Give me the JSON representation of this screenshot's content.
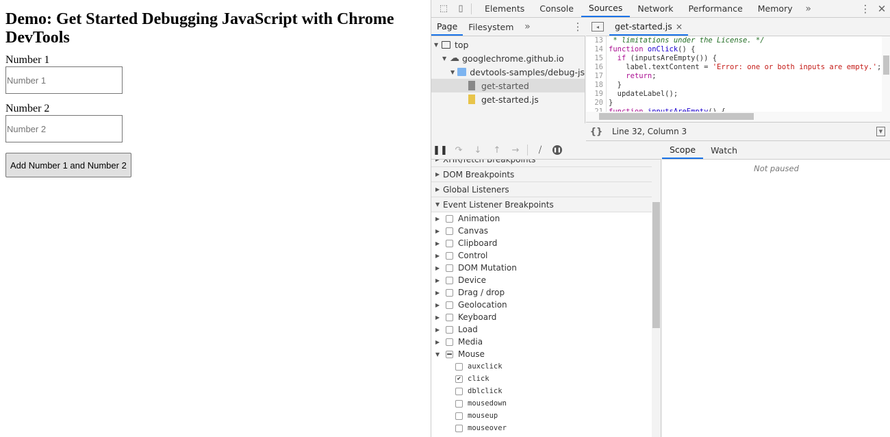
{
  "page": {
    "title": "Demo: Get Started Debugging JavaScript with Chrome DevTools",
    "label1": "Number 1",
    "placeholder1": "Number 1",
    "label2": "Number 2",
    "placeholder2": "Number 2",
    "button": "Add Number 1 and Number 2"
  },
  "devtools": {
    "tabs": [
      "Elements",
      "Console",
      "Sources",
      "Network",
      "Performance",
      "Memory"
    ],
    "active_tab": "Sources",
    "navigator_tabs": [
      "Page",
      "Filesystem"
    ],
    "tree": [
      "top",
      "googlechrome.github.io",
      "devtools-samples/debug-js",
      "get-started",
      "get-started.js"
    ],
    "editor_tab": "get-started.js",
    "code_lines": [
      {
        "n": "13",
        "html": "<span class='c'> * limitations under the License. */</span>"
      },
      {
        "n": "14",
        "html": "<span class='k'>function</span> <span class='f'>onClick</span>() {"
      },
      {
        "n": "15",
        "html": "  <span class='k'>if</span> (inputsAreEmpty()) {"
      },
      {
        "n": "16",
        "html": "    label.textContent = <span class='s'>'Error: one or both inputs are empty.'</span>;"
      },
      {
        "n": "17",
        "html": "    <span class='k'>return</span>;"
      },
      {
        "n": "18",
        "html": "  }"
      },
      {
        "n": "19",
        "html": "  updateLabel();"
      },
      {
        "n": "20",
        "html": "}"
      },
      {
        "n": "21",
        "html": "<span class='k'>function</span> <span class='f'>inputsAreEmpty</span>() {"
      },
      {
        "n": "22",
        "html": ""
      }
    ],
    "status": "Line 32, Column 3",
    "sections": [
      "XHR/fetch Breakpoints",
      "DOM Breakpoints",
      "Global Listeners",
      "Event Listener Breakpoints"
    ],
    "events": [
      {
        "label": "Animation"
      },
      {
        "label": "Canvas"
      },
      {
        "label": "Clipboard"
      },
      {
        "label": "Control"
      },
      {
        "label": "DOM Mutation"
      },
      {
        "label": "Device"
      },
      {
        "label": "Drag / drop"
      },
      {
        "label": "Geolocation"
      },
      {
        "label": "Keyboard"
      },
      {
        "label": "Load"
      },
      {
        "label": "Media"
      },
      {
        "label": "Mouse",
        "expanded": true,
        "state": "mixed"
      }
    ],
    "mouse_events": [
      {
        "label": "auxclick",
        "checked": false
      },
      {
        "label": "click",
        "checked": true
      },
      {
        "label": "dblclick",
        "checked": false
      },
      {
        "label": "mousedown",
        "checked": false
      },
      {
        "label": "mouseup",
        "checked": false
      },
      {
        "label": "mouseover",
        "checked": false
      }
    ],
    "right_tabs": [
      "Scope",
      "Watch"
    ],
    "not_paused": "Not paused"
  }
}
